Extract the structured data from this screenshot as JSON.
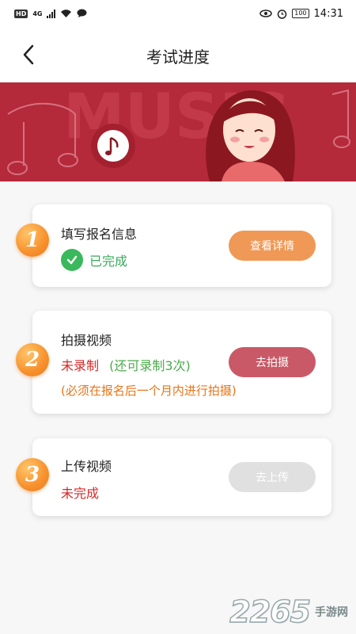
{
  "status_bar": {
    "left_badges": [
      "HD",
      "4G"
    ],
    "battery": "100",
    "time": "14:31",
    "icons": [
      "signal-icon",
      "wifi-icon",
      "chat-icon",
      "eye-icon",
      "alarm-icon",
      "battery-icon"
    ]
  },
  "header": {
    "title": "考试进度",
    "back_icon": "chevron-left-icon"
  },
  "banner": {
    "background_text": "MUSIC",
    "color": "#b42a3a"
  },
  "steps": [
    {
      "number": "1",
      "title": "填写报名信息",
      "status": "已完成",
      "button": "查看详情"
    },
    {
      "number": "2",
      "title": "拍摄视频",
      "status": "未录制",
      "remaining": "(还可录制3次)",
      "note": "(必须在报名后一个月内进行拍摄)",
      "button": "去拍摄"
    },
    {
      "number": "3",
      "title": "上传视频",
      "status": "未完成",
      "button": "去上传"
    }
  ],
  "watermark": {
    "number": "2265",
    "text": "手游网"
  },
  "colors": {
    "accent_orange": "#f09855",
    "accent_red": "#c95967",
    "success_green": "#3ab85c",
    "banner_red": "#b42a3a"
  }
}
